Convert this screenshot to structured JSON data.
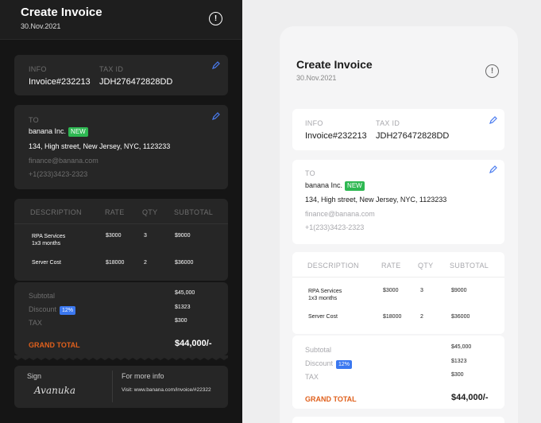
{
  "header": {
    "title": "Create Invoice",
    "date": "30.Nov.2021",
    "info_icon": "exclamation-circle-icon"
  },
  "info": {
    "label": "INFO",
    "tax_label": "TAX ID",
    "invoice": "Invoice#232213",
    "tax_id": "JDH276472828DD"
  },
  "to": {
    "label": "TO",
    "company": "banana Inc.",
    "badge": "NEW",
    "address": "134, High street, New Jersey, NYC, 1123233",
    "email": "finance@banana.com",
    "phone": "+1(233)3423-2323"
  },
  "table": {
    "headers": {
      "description": "DESCRIPTION",
      "rate": "RATE",
      "qty": "QTY",
      "subtotal": "SUBTOTAL"
    },
    "rows": [
      {
        "description_line1": "RPA Services",
        "description_line2": "1x3 months",
        "rate": "$3000",
        "qty": "3",
        "subtotal": "$9000"
      },
      {
        "description_line1": "Server Cost",
        "description_line2": "",
        "rate": "$18000",
        "qty": "2",
        "subtotal": "$36000"
      }
    ]
  },
  "totals": {
    "subtotal_label": "Subtotal",
    "subtotal": "$45,000",
    "discount_label": "Discount",
    "discount_badge": "12%",
    "discount": "$1323",
    "tax_label": "TAX",
    "tax": "$300",
    "grand_label": "GRAND TOTAL",
    "grand": "$44,000/-"
  },
  "footer": {
    "sign_label": "Sign",
    "signature": "Avanuka",
    "more_label": "For more info",
    "visit": "Visit: www.banana.com/invoice/#22322"
  },
  "colors": {
    "accent_orange": "#e0601c",
    "badge_green": "#2eb852",
    "badge_blue": "#3b78f0",
    "dark_bg": "#151515",
    "card_dark": "#262626"
  }
}
